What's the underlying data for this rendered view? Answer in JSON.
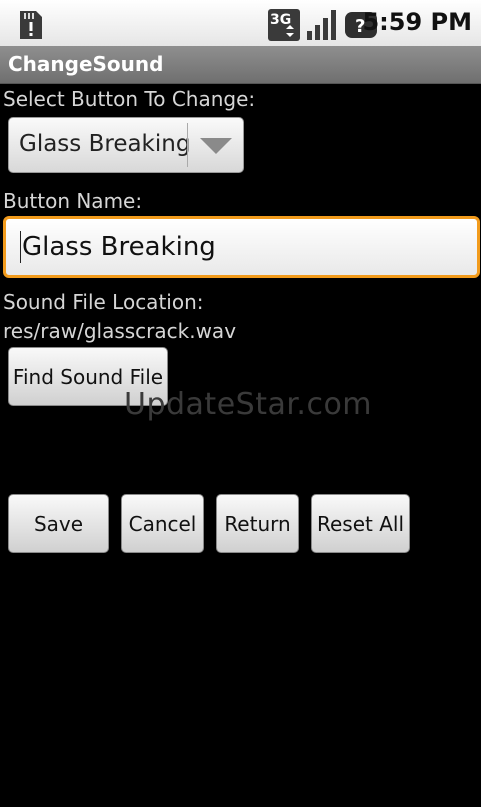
{
  "status_bar": {
    "time": "5:59 PM",
    "network": "3G",
    "icons": [
      "sd-card-warning-icon",
      "network-3g-icon",
      "signal-strength-icon",
      "help-icon"
    ]
  },
  "app": {
    "title": "ChangeSound"
  },
  "form": {
    "select_label": "Select Button To Change:",
    "selected_button": "Glass Breaking",
    "name_label": "Button Name:",
    "name_value": "Glass Breaking",
    "location_label": "Sound File Location:",
    "location_value": "res/raw/glasscrack.wav",
    "find_button": "Find Sound File"
  },
  "actions": {
    "save": "Save",
    "cancel": "Cancel",
    "return": "Return",
    "reset_all": "Reset All"
  },
  "watermark": "UpdateStar.com",
  "colors": {
    "focus_border": "#f29b1c",
    "title_bar": "#7f7f7f",
    "background": "#000000"
  }
}
